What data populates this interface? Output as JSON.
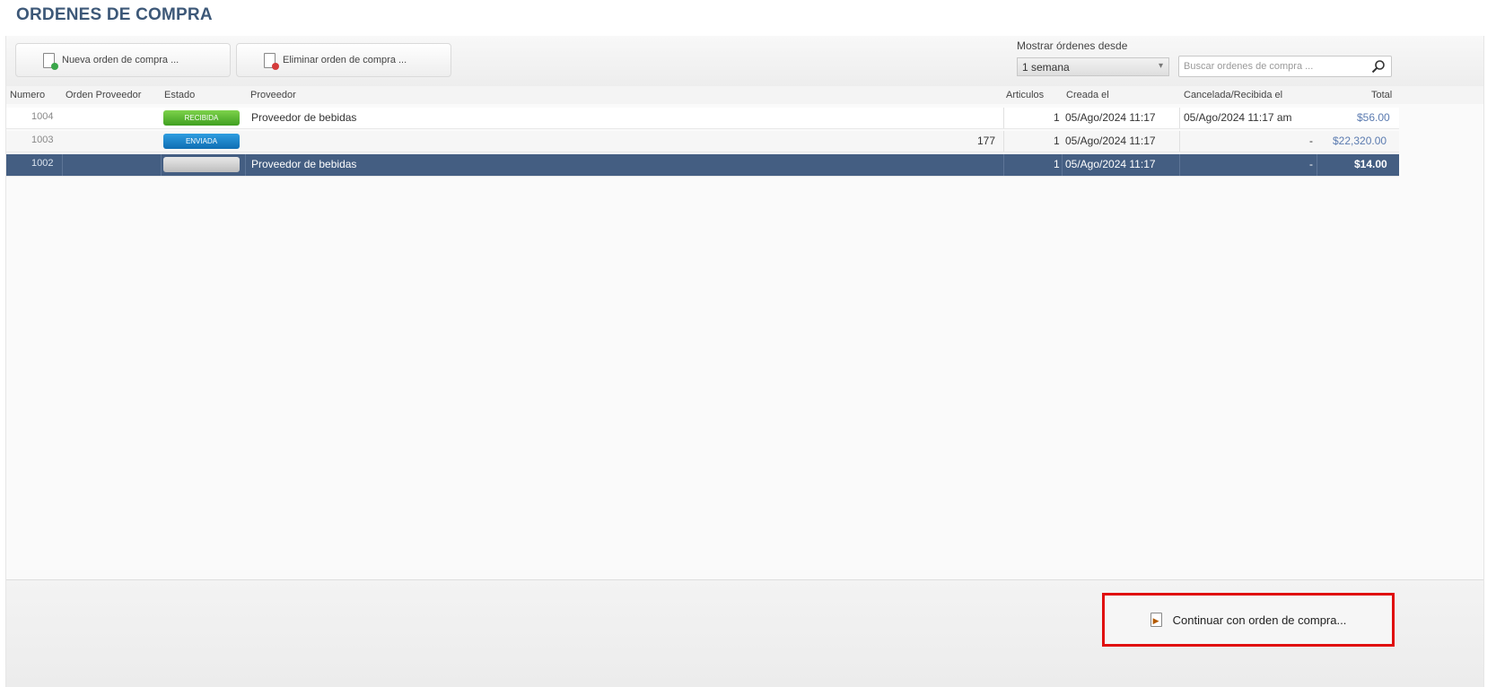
{
  "page": {
    "title": "ORDENES DE COMPRA"
  },
  "toolbar": {
    "new_label": "Nueva orden de compra ...",
    "delete_label": "Eliminar orden de compra ..."
  },
  "filter": {
    "label": "Mostrar órdenes desde",
    "selected": "1 semana"
  },
  "search": {
    "placeholder": "Buscar ordenes de compra ..."
  },
  "table": {
    "columns": [
      "Numero",
      "Orden Proveedor",
      "Estado",
      "Proveedor",
      "Articulos",
      "Creada el",
      "Cancelada/Recibida el",
      "Total"
    ],
    "rows": [
      {
        "numero": "1004",
        "orden_proveedor": "",
        "estado": "RECIBIDA",
        "estado_color": "#4cae2a",
        "proveedor": "Proveedor de bebidas",
        "extra": "",
        "articulos": "1",
        "creada": "05/Ago/2024 11:17",
        "recibida": "05/Ago/2024 11:17 am",
        "total": "$56.00"
      },
      {
        "numero": "1003",
        "orden_proveedor": "",
        "estado": "ENVIADA",
        "estado_color": "#1a82c8",
        "proveedor": "",
        "extra": "177",
        "articulos": "1",
        "creada": "05/Ago/2024 11:17",
        "recibida": "-",
        "total": "$22,320.00"
      },
      {
        "numero": "1002",
        "orden_proveedor": "",
        "estado": "",
        "estado_color": "#cfcfcf",
        "proveedor": "Proveedor de bebidas",
        "extra": "",
        "articulos": "1",
        "creada": "05/Ago/2024 11:17",
        "recibida": "-",
        "total": "$14.00"
      }
    ]
  },
  "footer": {
    "continue_label": "Continuar con orden de compra..."
  },
  "colors": {
    "title": "#3d5878",
    "selected_row": "#445e82",
    "highlight_border": "#e00d0d"
  }
}
